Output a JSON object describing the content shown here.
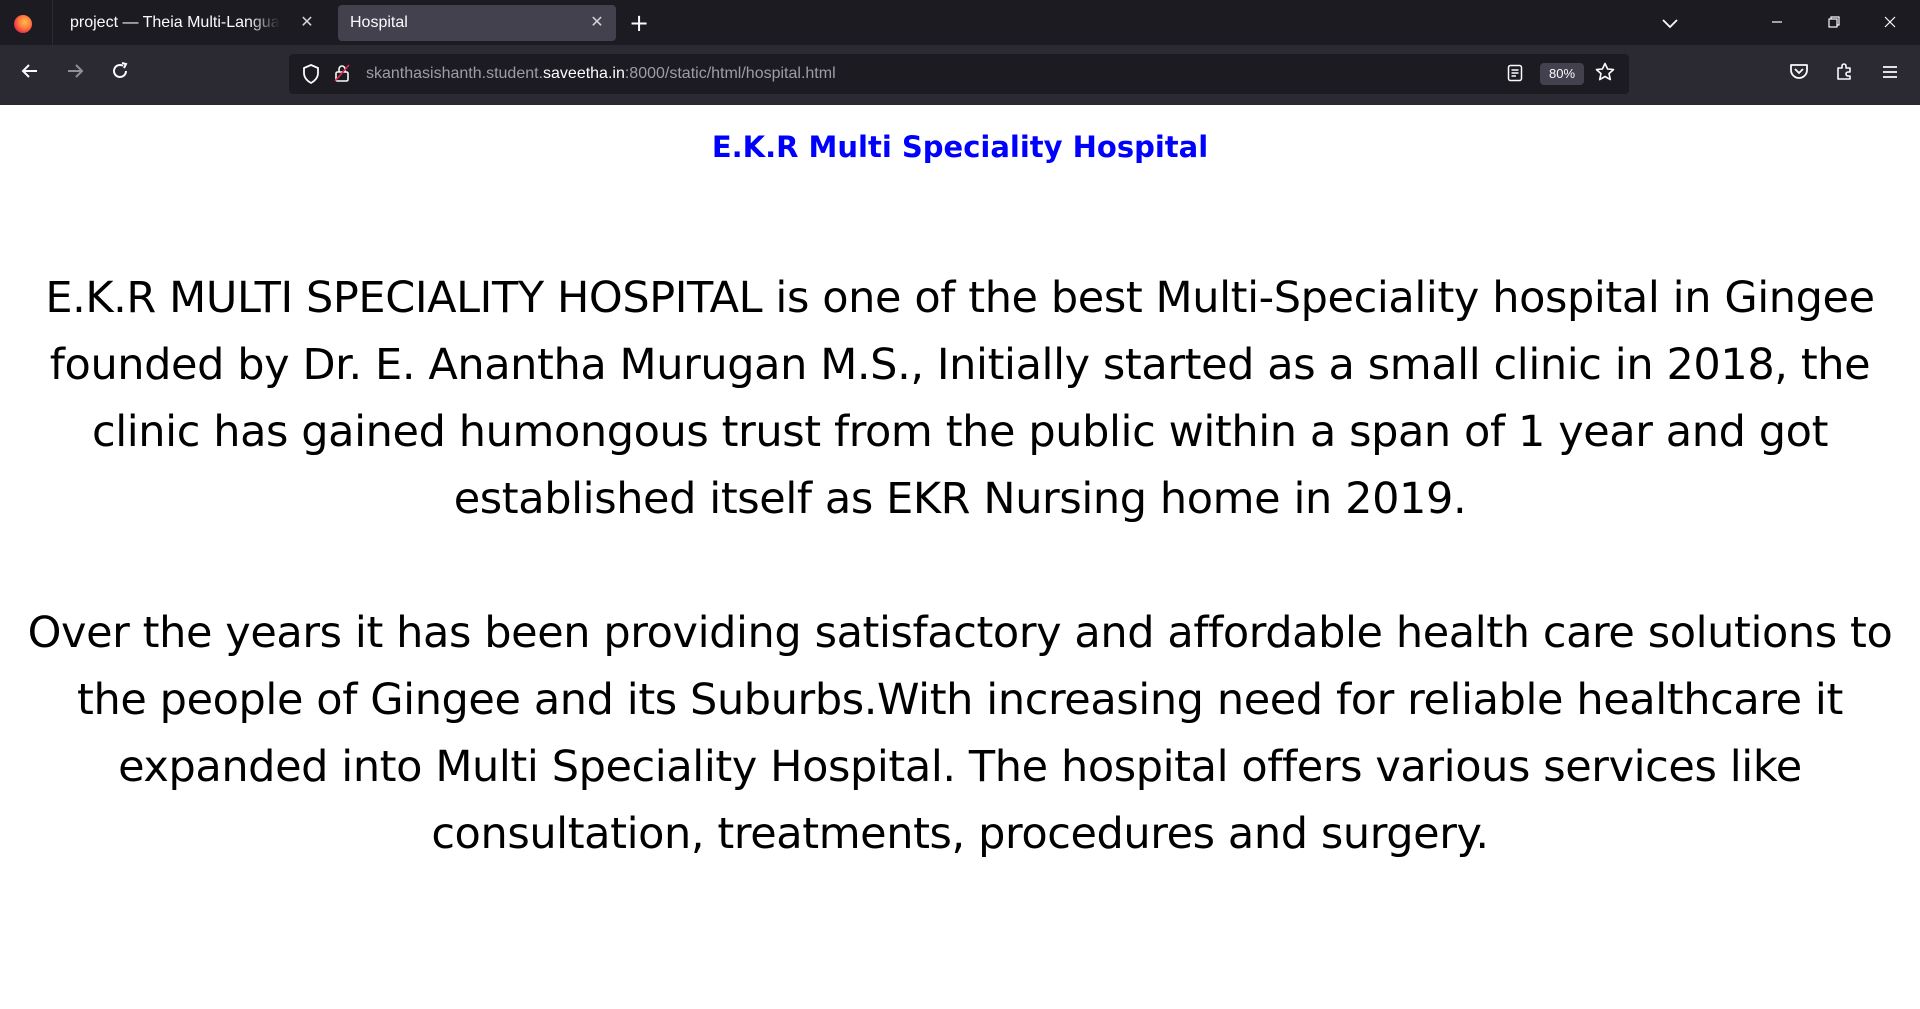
{
  "browser": {
    "tabs": [
      {
        "label": "project — Theia Multi-Language Ex",
        "active": false
      },
      {
        "label": "Hospital",
        "active": true
      }
    ],
    "icons": {
      "app": "firefox-icon",
      "tab_close": "close-icon",
      "new_tab": "plus-icon",
      "list_tabs": "chevron-down-icon",
      "minimize": "minimize-icon",
      "restore": "restore-icon",
      "close_window": "close-icon"
    },
    "nav": {
      "back": "back-arrow-icon",
      "forward": "forward-arrow-icon",
      "reload": "reload-icon"
    },
    "url": {
      "prefix": "skanthasishanth.student.",
      "host": "saveetha.in",
      "suffix": ":8000/static/html/hospital.html"
    },
    "zoom": "80%",
    "toolbar_icons": [
      "pocket-icon",
      "extensions-icon",
      "menu-icon"
    ]
  },
  "page": {
    "heading": "E.K.R Multi Speciality Hospital",
    "heading_color": "#0000ff",
    "paragraphs": [
      "E.K.R MULTI SPECIALITY HOSPITAL is one of the best Multi-Speciality hospital in Gingee founded by Dr. E. Anantha Murugan M.S., Initially started as a small clinic in 2018, the clinic has gained humongous trust from the public within a span of 1 year and got established itself as EKR Nursing home in 2019.",
      "Over the years it has been providing satisfactory and affordable health care solutions to the people of Gingee and its Suburbs.With increasing need for reliable healthcare it expanded into Multi Speciality Hospital. The hospital offers various services like consultation, treatments, procedures and surgery."
    ]
  }
}
